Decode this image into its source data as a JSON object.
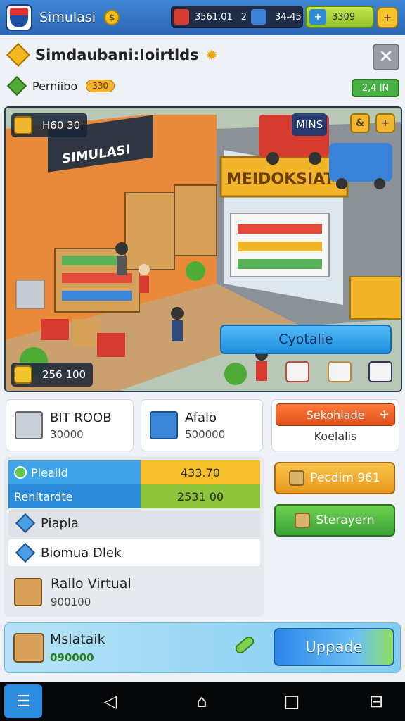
{
  "topbar": {
    "app_title": "Simulasi",
    "coin_icon_glyph": "$",
    "stats": [
      {
        "icon": "red-badge-icon",
        "value": "3561.01"
      },
      {
        "icon": "blue-box-icon",
        "value": "2"
      },
      {
        "icon": "coin-stack-icon",
        "value": "34-45"
      }
    ],
    "green_pill_icon_glyph": "+",
    "green_pill_value": "3309",
    "settings_glyph": "+"
  },
  "header": {
    "title": "Simdaubani:Ioirtlds",
    "subtitle": "Perniibo",
    "subtitle_badge": "330",
    "close_glyph": "✕",
    "right_badge": "2,4 IN"
  },
  "scene": {
    "top_left_label": "H60 30",
    "top_right_label": "MINS",
    "store_sign_left": "SIMULASI",
    "store_sign_right": "MEIDOKSIAT",
    "shop_button": "Cyotalie",
    "bottom_left_label": "256 100",
    "hex_left_glyph": "&",
    "hex_right_glyph": "+"
  },
  "cards": [
    {
      "title": "BIT ROOB",
      "value": "30000",
      "icon": "basket-icon"
    },
    {
      "title": "Afalo",
      "value": "500000",
      "icon": "box-icon"
    }
  ],
  "shelf_card": {
    "top": "Sekohlade",
    "top_icon_glyph": "✢",
    "bottom": "Koelalis"
  },
  "stat_bars": [
    {
      "label": "Pleaild",
      "value": "433.70",
      "color": "#f5c02a"
    },
    {
      "label": "Renltardte",
      "value": "2531 00",
      "color": "#8dc43a"
    }
  ],
  "list": [
    {
      "label": "Piapla"
    },
    {
      "label": "Biomua Dlek"
    }
  ],
  "product": {
    "title": "Rallo Virtual",
    "value": "900100"
  },
  "right_buttons": [
    {
      "label": "Pecdim 961",
      "style": "orange"
    },
    {
      "label": "Sterayern",
      "style": "green"
    }
  ],
  "bottom": {
    "title": "Mslataik",
    "value": "090000",
    "button": "Uppade"
  },
  "navbar": {
    "menu_glyph": "☰",
    "back_glyph": "◁",
    "home_glyph": "⌂",
    "recent_glyph": "□",
    "extra_glyph": "⊟"
  }
}
